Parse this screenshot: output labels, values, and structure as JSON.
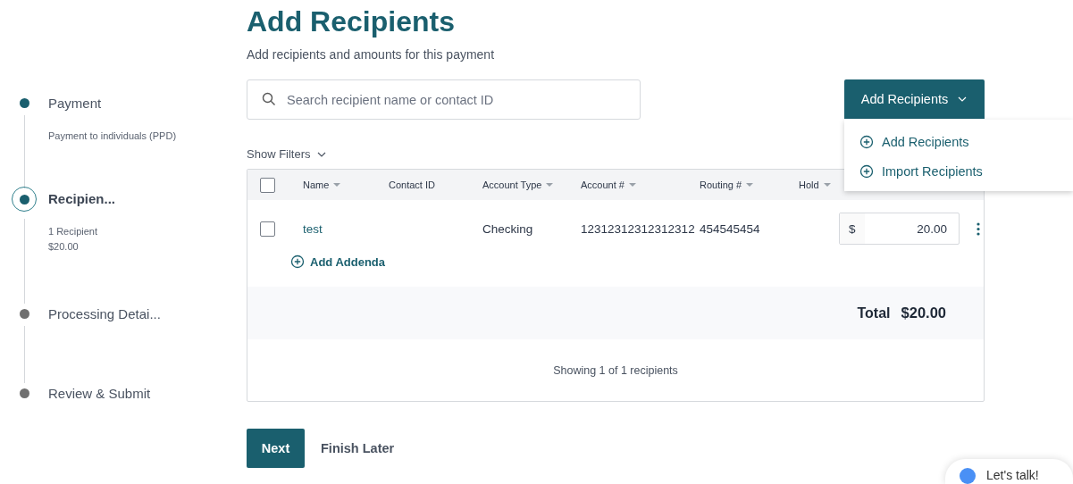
{
  "steps": [
    {
      "label": "Payment",
      "completed": true,
      "selected": false,
      "details": [
        "Payment to individuals (PPD)"
      ]
    },
    {
      "label": "Recipien...",
      "selected": true,
      "details": [
        "1 Recipient",
        "$20.00"
      ]
    },
    {
      "label": "Processing Detai...",
      "completed": false,
      "selected": false
    },
    {
      "label": "Review & Submit",
      "completed": false,
      "selected": false
    }
  ],
  "header": {
    "title": "Add Recipients",
    "subtitle": "Add recipients and amounts for this payment"
  },
  "search": {
    "placeholder": "Search recipient name or contact ID"
  },
  "add_button": {
    "label": "Add Recipients",
    "expanded": true,
    "menu": [
      {
        "label": "Add Recipients"
      },
      {
        "label": "Import Recipients"
      }
    ]
  },
  "filters_toggle": {
    "label": "Show Filters",
    "expanded": false
  },
  "table": {
    "all_checked": false,
    "columns": [
      {
        "label": "Name",
        "sortable": true
      },
      {
        "label": "Contact ID",
        "sortable": false
      },
      {
        "label": "Account Type",
        "sortable": true
      },
      {
        "label": "Account #",
        "sortable": true
      },
      {
        "label": "Routing #",
        "sortable": true
      },
      {
        "label": "Hold",
        "sortable": true
      }
    ],
    "rows": [
      {
        "checked": false,
        "name": "test",
        "account_type": "Checking",
        "account_number": "12312312312312312",
        "routing": "454545454",
        "currency": "$",
        "amount": "20.00",
        "addenda_link": "Add Addenda"
      }
    ],
    "total_label": "Total",
    "total_value": "$20.00",
    "footer": "Showing 1 of 1 recipients"
  },
  "actions": {
    "primary": "Next",
    "secondary": "Finish Later"
  },
  "chat": {
    "label": "Let's talk!"
  }
}
